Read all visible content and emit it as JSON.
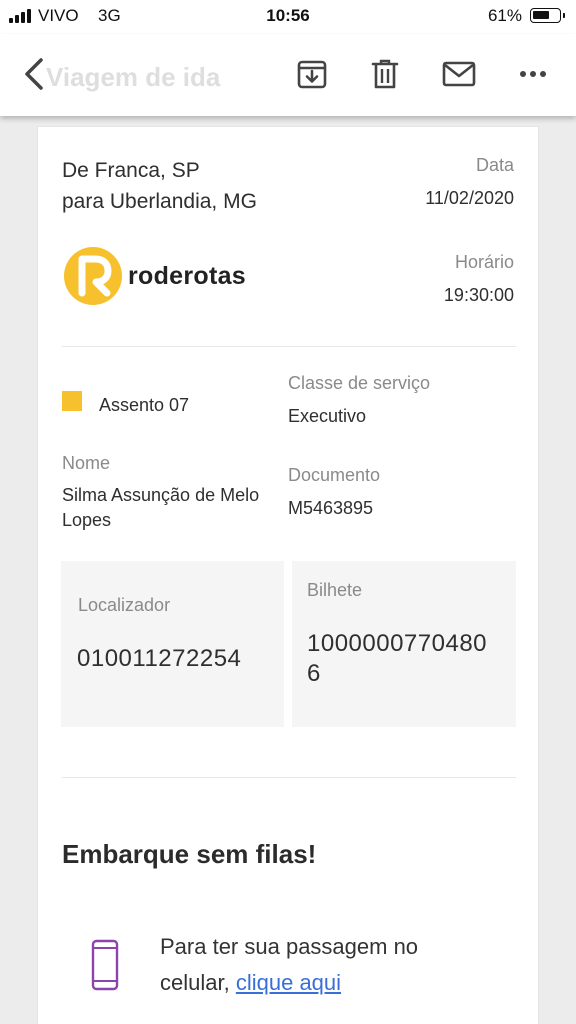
{
  "status_bar": {
    "carrier": "VIVO",
    "network": "3G",
    "time": "10:56",
    "battery": "61%",
    "battery_level": 0.61
  },
  "toolbar": {
    "subject": "Viagem de ida",
    "icons": [
      "back-icon",
      "archive-icon",
      "trash-icon",
      "mail-icon",
      "more-icon"
    ]
  },
  "ticket": {
    "route_from": "De Franca, SP",
    "route_to": "para Uberlandia, MG",
    "date_label": "Data",
    "date_value": "11/02/2020",
    "time_label": "Horário",
    "time_value": "19:30:00",
    "company": "roderotas",
    "seat_label": "Assento 07",
    "service_class_label": "Classe de serviço",
    "service_class_value": "Executivo",
    "name_label": "Nome",
    "name_value_line1": "Silma Assunção de Melo",
    "name_value_line2": "Lopes",
    "document_label": "Documento",
    "document_value": "M5463895",
    "locator_label": "Localizador",
    "locator_value": "010011272254",
    "ticket_label": "Bilhete",
    "ticket_value_line1": "1000000770480",
    "ticket_value_line2": "6"
  },
  "promo": {
    "heading": "Embarque sem filas!",
    "text_line1": "Para ter sua passagem no",
    "text_line2": "celular,",
    "link": "clique aqui"
  },
  "colors": {
    "accent_yellow": "#f6c12c",
    "link_blue": "#3a6fd8",
    "phone_icon_purple": "#8e44ad"
  }
}
